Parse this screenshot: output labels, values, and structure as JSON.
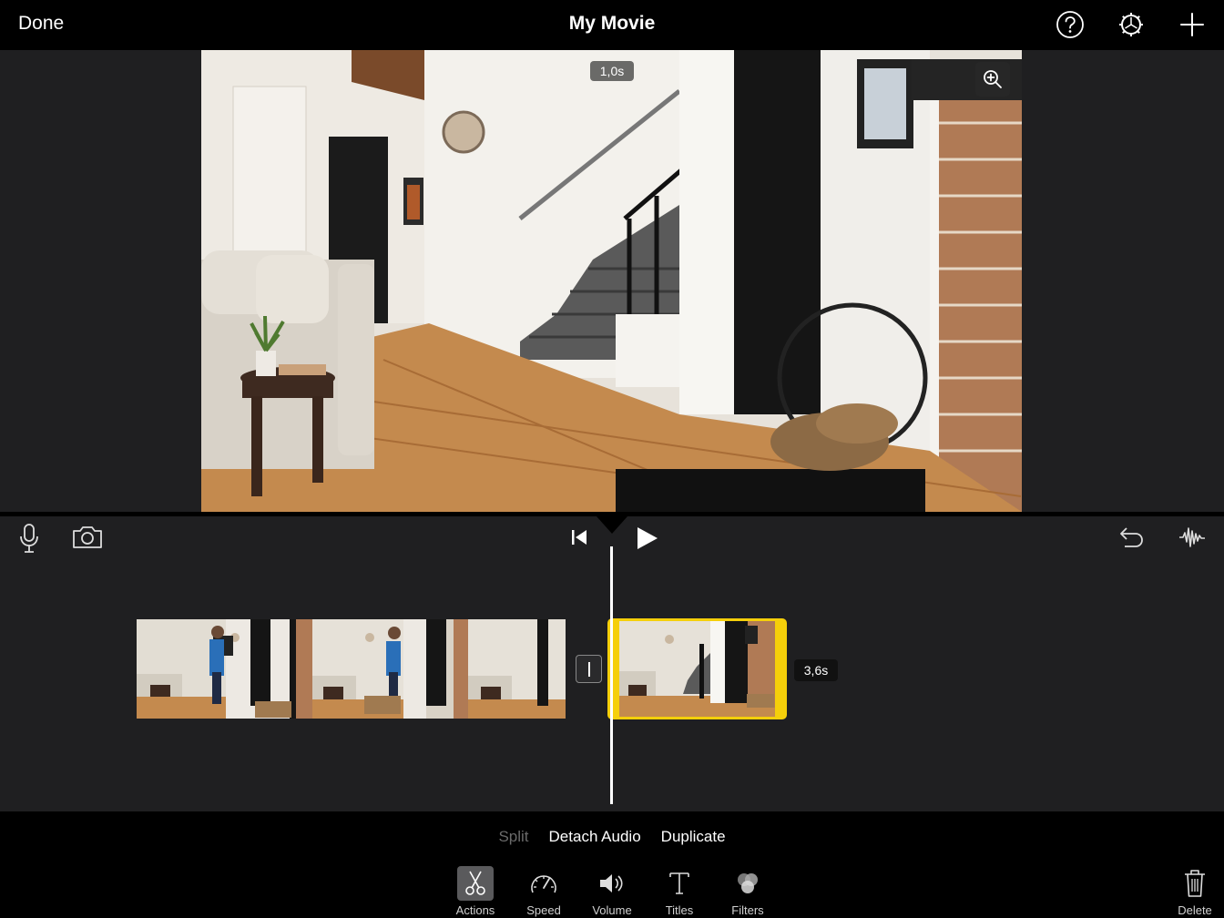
{
  "topbar": {
    "done_label": "Done",
    "title": "My Movie",
    "icons": [
      "help-icon",
      "settings-icon",
      "add-icon"
    ]
  },
  "viewer": {
    "time_badge": "1,0s",
    "zoom_icon": "zoom-in-icon"
  },
  "timeline": {
    "left_tools": [
      "microphone-icon",
      "camera-icon"
    ],
    "transport": [
      "skip-to-start-icon",
      "play-icon"
    ],
    "right_tools": [
      "undo-icon",
      "audio-waveform-icon"
    ],
    "selected_clip_duration": "3,6s"
  },
  "actions": {
    "split": "Split",
    "detach_audio": "Detach Audio",
    "duplicate": "Duplicate"
  },
  "toolbar": {
    "items": [
      {
        "label": "Actions",
        "icon": "scissors-icon",
        "selected": true
      },
      {
        "label": "Speed",
        "icon": "speedometer-icon",
        "selected": false
      },
      {
        "label": "Volume",
        "icon": "speaker-icon",
        "selected": false
      },
      {
        "label": "Titles",
        "icon": "text-icon",
        "selected": false
      },
      {
        "label": "Filters",
        "icon": "filters-icon",
        "selected": false
      }
    ],
    "delete_label": "Delete"
  },
  "colors": {
    "accent_selection": "#f5cf0a",
    "panel_background": "#1f1f21",
    "disabled_text": "#6a6a6a"
  }
}
